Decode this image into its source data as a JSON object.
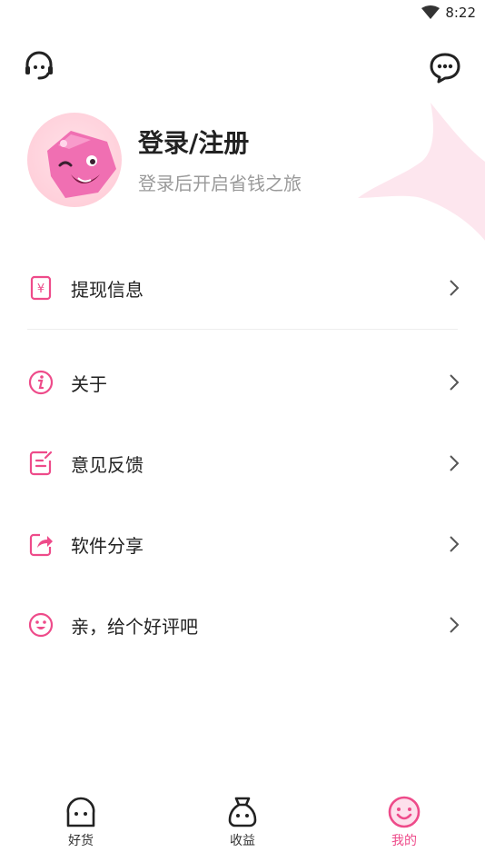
{
  "status_bar": {
    "time": "8:22"
  },
  "header": {
    "service_icon": "headset-icon",
    "message_icon": "chat-bubble-icon"
  },
  "profile": {
    "title": "登录/注册",
    "subtitle": "登录后开启省钱之旅"
  },
  "menu": {
    "items": [
      {
        "label": "提现信息",
        "icon": "yuan-card-icon"
      },
      {
        "label": "关于",
        "icon": "info-icon"
      },
      {
        "label": "意见反馈",
        "icon": "feedback-icon"
      },
      {
        "label": "软件分享",
        "icon": "share-icon"
      },
      {
        "label": "亲，给个好评吧",
        "icon": "smile-icon"
      }
    ]
  },
  "tabbar": {
    "tabs": [
      {
        "label": "好货",
        "icon": "ghost-icon",
        "active": false
      },
      {
        "label": "收益",
        "icon": "money-bag-icon",
        "active": false
      },
      {
        "label": "我的",
        "icon": "smiley-face-icon",
        "active": true
      }
    ]
  },
  "colors": {
    "accent": "#ee4b8a",
    "text": "#222222",
    "muted": "#9a9a9a"
  }
}
